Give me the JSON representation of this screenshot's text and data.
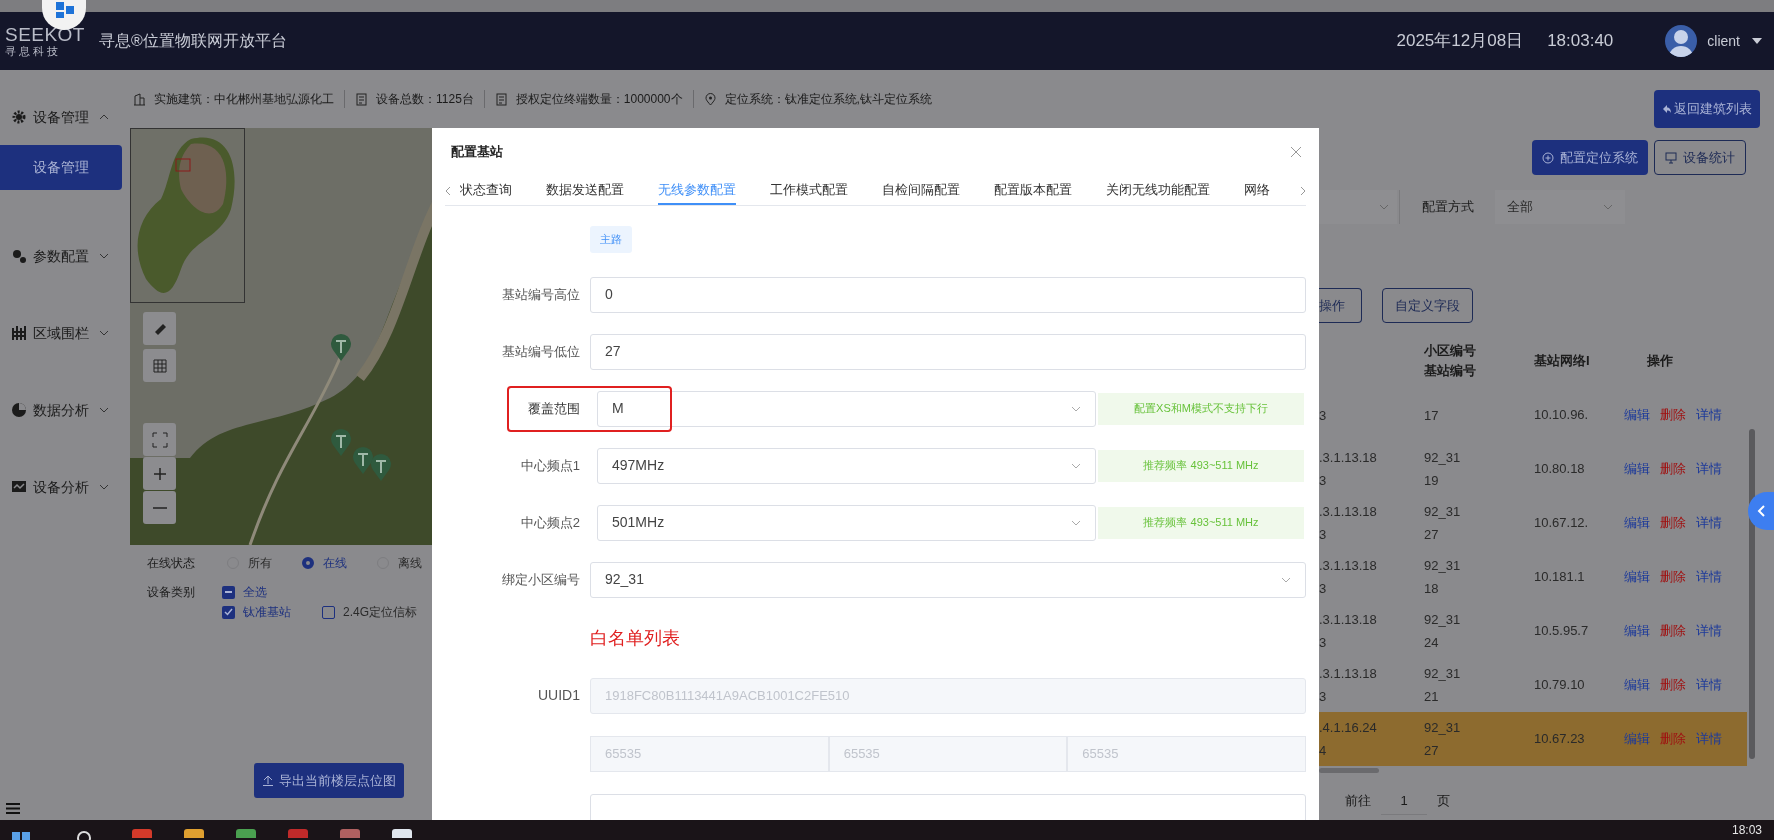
{
  "header": {
    "logo_text": "SEEKOT",
    "logo_subtitle": "寻 息 科 技",
    "title": "寻息®位置物联网开放平台",
    "date": "2025年12月08日",
    "time": "18:03:40",
    "user": "client"
  },
  "info_bar": [
    {
      "kind": "building",
      "text": "实施建筑：中化郴州基地弘源化工"
    },
    {
      "kind": "doc",
      "text": "设备总数：1125台"
    },
    {
      "kind": "doc",
      "text": "授权定位终端数量：1000000个"
    },
    {
      "kind": "pin",
      "text": "定位系统：钛准定位系统,钛斗定位系统"
    }
  ],
  "back_button": "返回建筑列表",
  "sidebar": [
    {
      "label": "设备管理",
      "kind": "gear",
      "expanded": true,
      "children": [
        {
          "label": "设备管理",
          "selected": true
        }
      ]
    },
    {
      "label": "参数配置",
      "kind": "gears",
      "expanded": false
    },
    {
      "label": "区域围栏",
      "kind": "fence",
      "expanded": false
    },
    {
      "label": "数据分析",
      "kind": "pie",
      "expanded": false
    },
    {
      "label": "设备分析",
      "kind": "monitor",
      "expanded": false
    }
  ],
  "filters": {
    "status_label": "在线状态",
    "status_options": [
      {
        "label": "所有",
        "selected": false
      },
      {
        "label": "在线",
        "selected": true
      },
      {
        "label": "离线",
        "selected": false
      }
    ],
    "type_label": "设备类别",
    "type_options": [
      {
        "label": "全选",
        "checked": true,
        "indeterminate": true
      },
      {
        "label": "钛准基站",
        "checked": true,
        "indeterminate": false
      },
      {
        "label": "2.4G定位信标",
        "checked": false,
        "indeterminate": false
      }
    ]
  },
  "export_button": "导出当前楼层点位图",
  "right_panel": {
    "buttons": [
      {
        "kind": "primary",
        "label": "配置定位系统"
      },
      {
        "kind": "outline",
        "label": "设备统计"
      }
    ],
    "filter_label": "配置方式",
    "filter_value": "全部",
    "table_buttons": [
      "操作",
      "自定义字段"
    ],
    "columns": [
      {
        "lines": [
          "小区编号",
          "基站编号"
        ]
      },
      {
        "lines": [
          "基站网络I"
        ]
      },
      {
        "lines": [
          "操作"
        ]
      }
    ],
    "rows": [
      {
        "column_1": [
          "3"
        ],
        "cell_id": [
          "17"
        ],
        "ip": "10.10.96.",
        "actions": [
          "编辑",
          "删除",
          "详情"
        ],
        "selected": false
      },
      {
        "column_1": [
          ".3.1.13.18",
          "3"
        ],
        "cell_id": [
          "92_31",
          "19"
        ],
        "ip": "10.80.18",
        "actions": [
          "编辑",
          "删除",
          "详情"
        ],
        "selected": false
      },
      {
        "column_1": [
          ".3.1.13.18",
          "3"
        ],
        "cell_id": [
          "92_31",
          "27"
        ],
        "ip": "10.67.12.",
        "actions": [
          "编辑",
          "删除",
          "详情"
        ],
        "selected": false
      },
      {
        "column_1": [
          ".3.1.13.18",
          "3"
        ],
        "cell_id": [
          "92_31",
          "18"
        ],
        "ip": "10.181.1",
        "actions": [
          "编辑",
          "删除",
          "详情"
        ],
        "selected": false
      },
      {
        "column_1": [
          ".3.1.13.18",
          "3"
        ],
        "cell_id": [
          "92_31",
          "24"
        ],
        "ip": "10.5.95.7",
        "actions": [
          "编辑",
          "删除",
          "详情"
        ],
        "selected": false
      },
      {
        "column_1": [
          ".3.1.13.18",
          "3"
        ],
        "cell_id": [
          "92_31",
          "21"
        ],
        "ip": "10.79.10",
        "actions": [
          "编辑",
          "删除",
          "详情"
        ],
        "selected": false
      },
      {
        "column_1": [
          ".4.1.16.24",
          "4"
        ],
        "cell_id": [
          "92_31",
          "27"
        ],
        "ip": "10.67.23",
        "actions": [
          "编辑",
          "删除",
          "详情"
        ],
        "selected": true
      }
    ],
    "pagination": {
      "goto": "前往",
      "page": "1",
      "unit": "页"
    }
  },
  "modal": {
    "title": "配置基站",
    "tabs": [
      {
        "label": "状态查询",
        "selected": false
      },
      {
        "label": "数据发送配置",
        "selected": false
      },
      {
        "label": "无线参数配置",
        "selected": true
      },
      {
        "label": "工作模式配置",
        "selected": false
      },
      {
        "label": "自检间隔配置",
        "selected": false
      },
      {
        "label": "配置版本配置",
        "selected": false
      },
      {
        "label": "关闭无线功能配置",
        "selected": false
      },
      {
        "label": "网络",
        "selected": false
      }
    ],
    "tag": "主路",
    "fields": [
      {
        "kind": "input",
        "label": "基站编号高位",
        "value": "0",
        "highlighted": false
      },
      {
        "kind": "input",
        "label": "基站编号低位",
        "value": "27",
        "highlighted": false
      },
      {
        "kind": "select",
        "label": "覆盖范围",
        "value": "M",
        "hint": "配置XS和M模式不支持下行",
        "highlighted": true
      },
      {
        "kind": "select",
        "label": "中心频点1",
        "value": "497MHz",
        "hint": "推荐频率 493~511 MHz",
        "highlighted": false
      },
      {
        "kind": "select",
        "label": "中心频点2",
        "value": "501MHz",
        "hint": "推荐频率 493~511 MHz",
        "highlighted": false
      },
      {
        "kind": "select",
        "label": "绑定小区编号",
        "value": "92_31",
        "highlighted": false
      }
    ],
    "whitelist_title": "白名单列表",
    "uuid_label": "UUID1",
    "uuid_value": "1918FC80B1113441A9ACB1001C2FE510",
    "uuid_parts": [
      "65535",
      "65535",
      "65535"
    ]
  },
  "taskbar": {
    "time": "18:03"
  }
}
